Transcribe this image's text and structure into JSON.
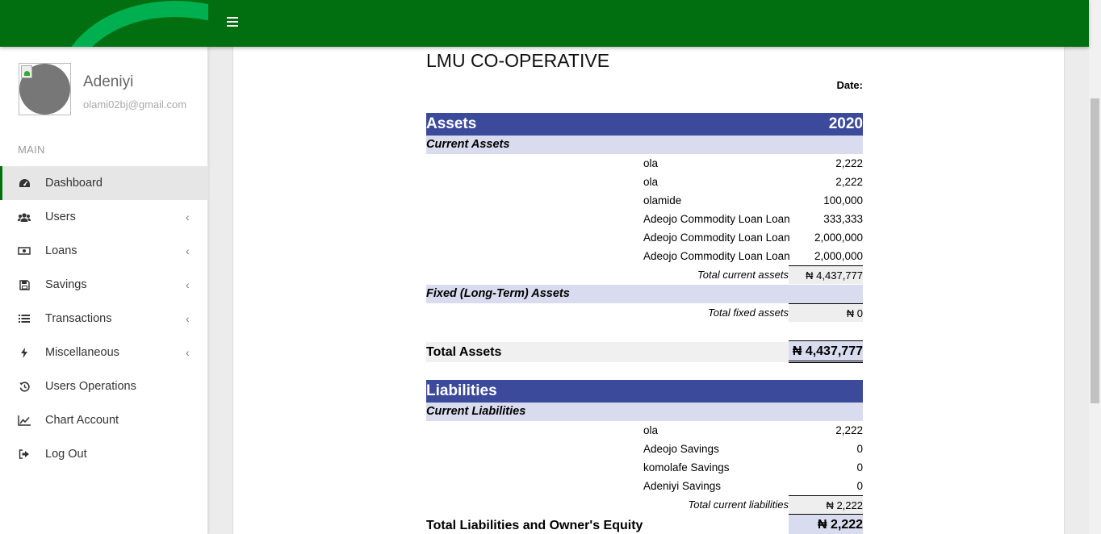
{
  "sidebar": {
    "user_name": "Adeniyi",
    "user_email": "olami02bj@gmail.com",
    "section_label": "MAIN",
    "items": [
      {
        "label": "Dashboard",
        "icon": "dashboard-icon"
      },
      {
        "label": "Users",
        "icon": "users-icon"
      },
      {
        "label": "Loans",
        "icon": "money-icon"
      },
      {
        "label": "Savings",
        "icon": "save-icon"
      },
      {
        "label": "Transactions",
        "icon": "list-icon"
      },
      {
        "label": "Miscellaneous",
        "icon": "bolt-icon"
      },
      {
        "label": "Users Operations",
        "icon": "history-icon"
      },
      {
        "label": "Chart Account",
        "icon": "line-chart-icon"
      },
      {
        "label": "Log Out",
        "icon": "sign-out-icon"
      }
    ]
  },
  "report": {
    "title": "LMU CO-OPERATIVE",
    "date_label": "Date:",
    "assets": {
      "header": "Assets",
      "year": "2020",
      "current_label": "Current Assets",
      "current_items": [
        {
          "name": "ola",
          "value": "2,222"
        },
        {
          "name": "ola",
          "value": "2,222"
        },
        {
          "name": "olamide",
          "value": "100,000"
        },
        {
          "name": "Adeojo Commodity Loan Loan",
          "value": "333,333"
        },
        {
          "name": "Adeojo Commodity Loan Loan",
          "value": "2,000,000"
        },
        {
          "name": "Adeojo Commodity Loan Loan",
          "value": "2,000,000"
        }
      ],
      "total_current_label": "Total current assets",
      "total_current_value": "₦ 4,437,777",
      "fixed_label": "Fixed (Long-Term) Assets",
      "total_fixed_label": "Total fixed assets",
      "total_fixed_value": "₦ 0",
      "total_label": "Total Assets",
      "total_value": "₦ 4,437,777"
    },
    "liabilities": {
      "header": "Liabilities",
      "current_label": "Current Liabilities",
      "current_items": [
        {
          "name": "ola",
          "value": "2,222"
        },
        {
          "name": "Adeojo Savings",
          "value": "0"
        },
        {
          "name": "komolafe Savings",
          "value": "0"
        },
        {
          "name": "Adeniyi Savings",
          "value": "0"
        }
      ],
      "total_current_label": "Total current liabilities",
      "total_current_value": "₦ 2,222",
      "total_label": "Total Liabilities and Owner's Equity",
      "total_value": "₦ 2,222"
    }
  },
  "colors": {
    "topbar": "#016e10",
    "table_header": "#3c4a9c",
    "subheader": "#d9dcee"
  }
}
